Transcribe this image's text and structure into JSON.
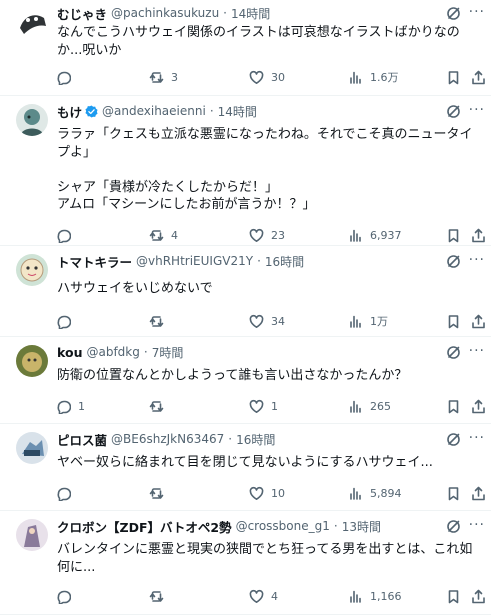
{
  "posts": [
    {
      "name": "むじゃき",
      "verified": false,
      "handle": "@pachinkasukuzu",
      "time": "14時間",
      "text": "なんでこうハサウェイ関係のイラストは可哀想なイラストばかりなのか...呪いか",
      "replies": "",
      "reposts": "3",
      "likes": "30",
      "views": "1.6万",
      "avatar_color": "#2f3336"
    },
    {
      "name": "もけ",
      "verified": true,
      "handle": "@andexihaeienni",
      "time": "14時間",
      "text": "ララァ「クェスも立派な悪霊になったわね。それでこそ真のニュータイプよ」\n\nシャア「貴様が冷たくしたからだ！」\nアムロ「マシーンにしたお前が言うか！？」",
      "replies": "",
      "reposts": "4",
      "likes": "23",
      "views": "6,937",
      "avatar_color": "#5c8a8a"
    },
    {
      "name": "トマトキラー",
      "verified": false,
      "handle": "@vhRHtriEUIGV21Y",
      "time": "16時間",
      "text": "ハサウェイをいじめないで",
      "replies": "",
      "reposts": "",
      "likes": "34",
      "views": "1万",
      "avatar_color": "#cfe3d6"
    },
    {
      "name": "kou",
      "verified": false,
      "handle": "@abfdkg",
      "time": "7時間",
      "text": "防衛の位置なんとかしようって誰も言い出さなかったんか？",
      "replies": "1",
      "reposts": "",
      "likes": "1",
      "views": "265",
      "avatar_color": "#c9b46a"
    },
    {
      "name": "ピロス菌",
      "verified": false,
      "handle": "@BE6shzJkN63467",
      "time": "16時間",
      "text": "ヤベー奴らに絡まれて目を閉じて見ないようにするハサウェイ...",
      "replies": "",
      "reposts": "",
      "likes": "10",
      "views": "5,894",
      "avatar_color": "#6b8fb0"
    },
    {
      "name": "クロボン【ZDF】バトオペ2勢",
      "verified": false,
      "handle": "@crossbone_g1",
      "time": "13時間",
      "text": "バレンタインに悪霊と現実の狭間でとち狂ってる男を出すとは、これ如何に...",
      "replies": "",
      "reposts": "",
      "likes": "4",
      "views": "1,166",
      "avatar_color": "#8a7a9a"
    }
  ],
  "icons": {
    "reply": "reply-icon",
    "repost": "repost-icon",
    "like": "heart-icon",
    "views": "views-icon",
    "bookmark": "bookmark-icon",
    "share": "share-icon",
    "grok": "grok-icon",
    "more": "more-icon",
    "verified": "verified-badge-icon"
  },
  "colors": {
    "text": "#0f1419",
    "secondary": "#536471",
    "verified": "#1d9bf0",
    "divider": "#eff3f4"
  }
}
